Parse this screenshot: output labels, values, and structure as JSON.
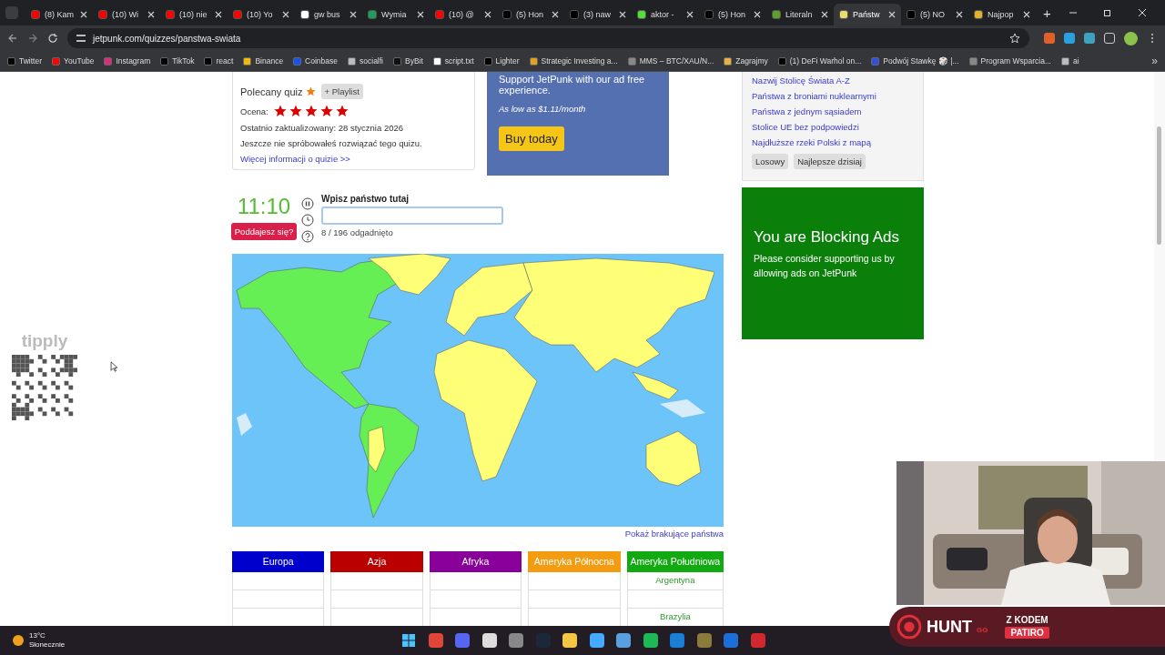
{
  "browser": {
    "tabs": [
      {
        "title": "(8) Kam",
        "selected": false,
        "color": "#ff0000"
      },
      {
        "title": "(10) Wi",
        "selected": false,
        "color": "#ff0000"
      },
      {
        "title": "(10) nie",
        "selected": false,
        "color": "#ff0000"
      },
      {
        "title": "(10) Yo",
        "selected": false,
        "color": "#ff0000"
      },
      {
        "title": "gw bus",
        "selected": false,
        "color": "#ffffff"
      },
      {
        "title": "Wymia",
        "selected": false,
        "color": "#1e9e5a"
      },
      {
        "title": "(10) @",
        "selected": false,
        "color": "#ff0000"
      },
      {
        "title": "(5) Hon",
        "selected": false,
        "color": "#000000"
      },
      {
        "title": "(3) naw",
        "selected": false,
        "color": "#000000"
      },
      {
        "title": "aktor -",
        "selected": false,
        "color": "#53e03a"
      },
      {
        "title": "(5) Hon",
        "selected": false,
        "color": "#000000"
      },
      {
        "title": "Literaln",
        "selected": false,
        "color": "#5aa02c"
      },
      {
        "title": "Państw",
        "selected": true,
        "color": "#e8e06a"
      },
      {
        "title": "(5) NO",
        "selected": false,
        "color": "#000000"
      },
      {
        "title": "Najpop",
        "selected": false,
        "color": "#e0b030"
      }
    ],
    "new_tab": "+",
    "address": "jetpunk.com/quizzes/panstwa-swiata",
    "bookmarks": [
      {
        "label": "Twitter",
        "color": "#000000"
      },
      {
        "label": "YouTube",
        "color": "#ff0000"
      },
      {
        "label": "Instagram",
        "color": "#d6307a"
      },
      {
        "label": "TikTok",
        "color": "#000000"
      },
      {
        "label": "react",
        "color": "#000000"
      },
      {
        "label": "Binance",
        "color": "#f0b90b"
      },
      {
        "label": "Coinbase",
        "color": "#1652f0"
      },
      {
        "label": "socialfi",
        "color": "#bbbbbb"
      },
      {
        "label": "ByBit",
        "color": "#111111"
      },
      {
        "label": "script.txt",
        "color": "#ffffff"
      },
      {
        "label": "Lighter",
        "color": "#000000"
      },
      {
        "label": "Strategic Investing a...",
        "color": "#e0a020"
      },
      {
        "label": "MMS – BTC/XAU/N...",
        "color": "#888888"
      },
      {
        "label": "Zagrajmy",
        "color": "#e8b040"
      },
      {
        "label": "(1) DeFi Warhol on...",
        "color": "#000000"
      },
      {
        "label": "Podwój Stawkę 🎲 |...",
        "color": "#3050e0"
      },
      {
        "label": "Program Wsparcia...",
        "color": "#888888"
      },
      {
        "label": "ai",
        "color": "#bbbbbb"
      }
    ],
    "more_bookmarks": "»"
  },
  "overlay": {
    "brand": "tipply"
  },
  "quiz_info": {
    "featured_label": "Polecany quiz",
    "playlist_button": "+ Playlist",
    "rating_label": "Ocena:",
    "stars": 5,
    "updated": "Ostatnio zaktualizowany: 28 stycznia 2026",
    "attempt_note": "Jeszcze nie spróbowałeś rozwiązać tego quizu.",
    "more_link": "Więcej informacji o quizie >>"
  },
  "promo": {
    "text": "Support JetPunk with our ad free experience.",
    "price": "As low as $1.11/month",
    "button": "Buy today"
  },
  "game": {
    "timer": "11:10",
    "give_up_button": "Poddajesz się?",
    "input_label": "Wpisz państwo tutaj",
    "progress": "8 / 196 odgadnięto",
    "show_missing_link": "Pokaż brakujące państwa"
  },
  "answers_table": {
    "columns": [
      {
        "label": "Europa",
        "color": "#0000cc",
        "cells": [
          {},
          {},
          {}
        ]
      },
      {
        "label": "Azja",
        "color": "#bb0000",
        "cells": [
          {},
          {},
          {}
        ]
      },
      {
        "label": "Afryka",
        "color": "#880099",
        "cells": [
          {},
          {},
          {}
        ]
      },
      {
        "label": "Ameryka Północna",
        "color": "#f39c12",
        "cells": [
          {},
          {},
          {}
        ]
      },
      {
        "label": "Ameryka Południowa",
        "color": "#11aa11",
        "cells": [
          {
            "answer": "Argentyna"
          },
          {},
          {
            "answer": "Brazylia"
          }
        ]
      }
    ]
  },
  "sidebar": {
    "links": [
      "Nazwij Stolicę Świata A-Z",
      "Państwa z broniami nuklearnymi",
      "Państwa z jednym sąsiadem",
      "Stolice UE bez podpowiedzi",
      "Najdłuższe rzeki Polski z mapą"
    ],
    "buttons": [
      "Losowy",
      "Najlepsze dzisiaj"
    ]
  },
  "ad_block_notice": {
    "title": "You are Blocking Ads",
    "text": "Please consider supporting us by allowing ads on JetPunk"
  },
  "stream_banner": {
    "brand": "HUNT",
    "brand_suffix": "GG",
    "code_label": "Z KODEM",
    "code": "PATIRO"
  },
  "taskbar": {
    "temperature": "13°C",
    "weather": "Słonecznie"
  }
}
